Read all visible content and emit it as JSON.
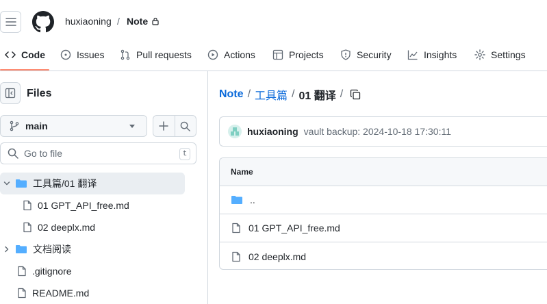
{
  "header": {
    "owner": "huxiaoning",
    "separator": "/",
    "repo": "Note"
  },
  "tabs": [
    {
      "label": "Code",
      "icon": "code-icon",
      "active": true
    },
    {
      "label": "Issues",
      "icon": "issue-opened-icon"
    },
    {
      "label": "Pull requests",
      "icon": "git-pull-request-icon"
    },
    {
      "label": "Actions",
      "icon": "play-icon"
    },
    {
      "label": "Projects",
      "icon": "table-icon"
    },
    {
      "label": "Security",
      "icon": "shield-icon"
    },
    {
      "label": "Insights",
      "icon": "graph-icon"
    },
    {
      "label": "Settings",
      "icon": "gear-icon"
    }
  ],
  "sidebar": {
    "title": "Files",
    "branch": "main",
    "search_placeholder": "Go to file",
    "search_shortcut": "t",
    "tree": [
      {
        "label": "工具篇/01 翻译",
        "type": "folder",
        "expanded": true,
        "selected": true
      },
      {
        "label": "01 GPT_API_free.md",
        "type": "file"
      },
      {
        "label": "02 deeplx.md",
        "type": "file"
      },
      {
        "label": "文档阅读",
        "type": "folder",
        "expanded": false
      },
      {
        "label": ".gitignore",
        "type": "file"
      },
      {
        "label": "README.md",
        "type": "file"
      }
    ]
  },
  "main": {
    "breadcrumb": {
      "repo": "Note",
      "sep": "/",
      "folder": "工具篇",
      "current": "01 翻译"
    },
    "commit": {
      "author": "huxiaoning",
      "message": "vault backup: 2024-10-18 17:30:11"
    },
    "table": {
      "header": "Name",
      "rows": [
        {
          "label": "..",
          "type": "parent"
        },
        {
          "label": "01 GPT_API_free.md",
          "type": "file"
        },
        {
          "label": "02 deeplx.md",
          "type": "file"
        }
      ]
    }
  },
  "colors": {
    "accent_link": "#0969da",
    "folder": "#54aeff",
    "tab_underline": "#fd8c73"
  }
}
